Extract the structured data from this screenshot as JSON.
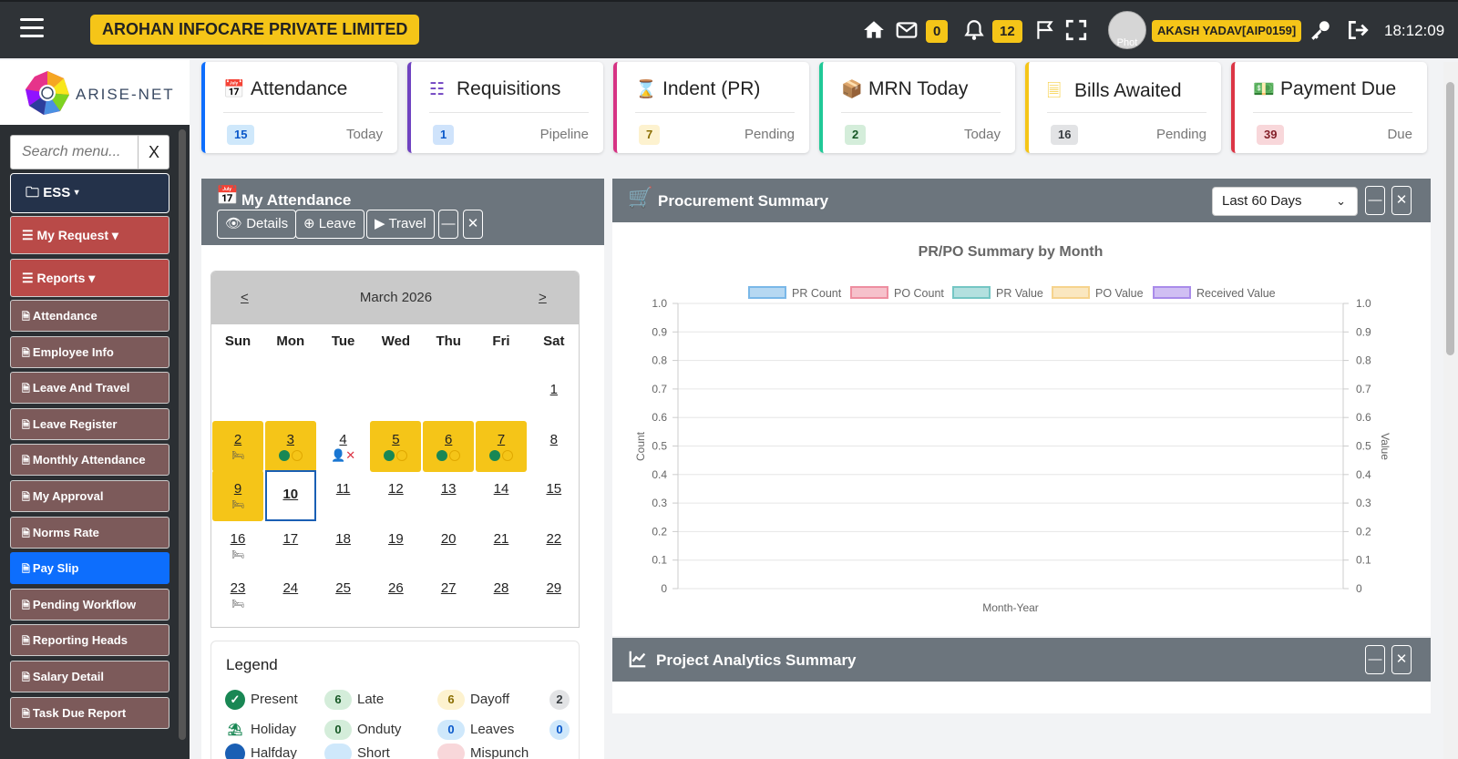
{
  "header": {
    "company": "AROHAN INFOCARE PRIVATE LIMITED",
    "mail_count": "0",
    "notif_count": "12",
    "avatar_alt": "Phot",
    "user": "AKASH YADAV[AIP0159]",
    "time": "18:12:09",
    "icons": [
      "menu-icon",
      "home-icon",
      "mail-icon",
      "bell-icon",
      "flag-icon",
      "fullscreen-icon",
      "key-icon",
      "logout-icon"
    ]
  },
  "sidebar": {
    "logo_text": "ARISE-NET",
    "search_placeholder": "Search menu...",
    "search_clear": "X",
    "ess": "ESS",
    "my_request": "My Request",
    "reports": "Reports",
    "items": [
      "Attendance",
      "Employee Info",
      "Leave And Travel",
      "Leave Register",
      "Monthly Attendance",
      "My Approval",
      "Norms Rate",
      "Pay Slip",
      "Pending Workflow",
      "Reporting Heads",
      "Salary Detail",
      "Task Due Report"
    ],
    "active_item": "Pay Slip"
  },
  "cards": [
    {
      "title": "Attendance",
      "count": "15",
      "sub": "Today",
      "color": "#0d6efd",
      "badge_bg": "#cfe8fb",
      "badge_fg": "#0a58ca",
      "icon": "calendar-check-icon"
    },
    {
      "title": "Requisitions",
      "count": "1",
      "sub": "Pipeline",
      "color": "#6f42c1",
      "badge_bg": "#cfe3fb",
      "badge_fg": "#0a58ca",
      "icon": "sitemap-icon"
    },
    {
      "title": "Indent (PR)",
      "count": "7",
      "sub": "Pending",
      "color": "#d63384",
      "badge_bg": "#fdf2cf",
      "badge_fg": "#8a6d00",
      "icon": "hourglass-icon"
    },
    {
      "title": "MRN Today",
      "count": "2",
      "sub": "Today",
      "color": "#20c997",
      "badge_bg": "#d4edda",
      "badge_fg": "#155724",
      "icon": "box-icon"
    },
    {
      "title": "Bills Awaited",
      "count": "16",
      "sub": "Pending",
      "color": "#f5c518",
      "badge_bg": "#e2e3e5",
      "badge_fg": "#383d41",
      "icon": "receipt-icon"
    },
    {
      "title": "Payment Due",
      "count": "39",
      "sub": "Due",
      "color": "#dc3545",
      "badge_bg": "#f8d7da",
      "badge_fg": "#842029",
      "icon": "money-icon"
    }
  ],
  "attendance": {
    "title": "My Attendance",
    "buttons": {
      "details": "Details",
      "leave": "Leave",
      "travel": "Travel"
    },
    "calendar": {
      "month": "March 2026",
      "prev": "<",
      "next": ">",
      "days_of_week": [
        "Sun",
        "Mon",
        "Tue",
        "Wed",
        "Thu",
        "Fri",
        "Sat"
      ],
      "today": 10
    },
    "legend": {
      "title": "Legend",
      "present": "Present",
      "late": "Late",
      "late_count": "6",
      "dayoff": "Dayoff",
      "dayoff_count": "6",
      "dayoff_total": "2",
      "holiday": "Holiday",
      "onduty": "Onduty",
      "onduty_count": "0",
      "leaves": "Leaves",
      "leaves_count": "0",
      "leaves_total": "0",
      "halfday": "Halfday",
      "short": "Short",
      "mispunch": "Mispunch"
    }
  },
  "procurement": {
    "title": "Procurement Summary",
    "range": "Last 60 Days",
    "chart": {
      "title": "PR/PO Summary by Month",
      "xlabel": "Month-Year",
      "ylabel": "Count",
      "y2label": "Value"
    }
  },
  "project_analytics": {
    "title": "Project Analytics Summary"
  },
  "chart_data": {
    "type": "bar",
    "title": "PR/PO Summary by Month",
    "xlabel": "Month-Year",
    "ylabel": "Count",
    "y2label": "Value",
    "categories": [],
    "ylim": [
      0,
      1
    ],
    "yticks": [
      "1.0",
      "0.9",
      "0.8",
      "0.7",
      "0.6",
      "0.5",
      "0.4",
      "0.3",
      "0.2",
      "0.1",
      "0"
    ],
    "series": [
      {
        "name": "PR Count",
        "values": [],
        "color": "#7ab8e8"
      },
      {
        "name": "PO Count",
        "values": [],
        "color": "#ee8ea0"
      },
      {
        "name": "PR Value",
        "values": [],
        "color": "#74c6c4"
      },
      {
        "name": "PO Value",
        "values": [],
        "color": "#f6d38d"
      },
      {
        "name": "Received Value",
        "values": [],
        "color": "#a98bea"
      }
    ],
    "legend": "top",
    "grid": true
  }
}
